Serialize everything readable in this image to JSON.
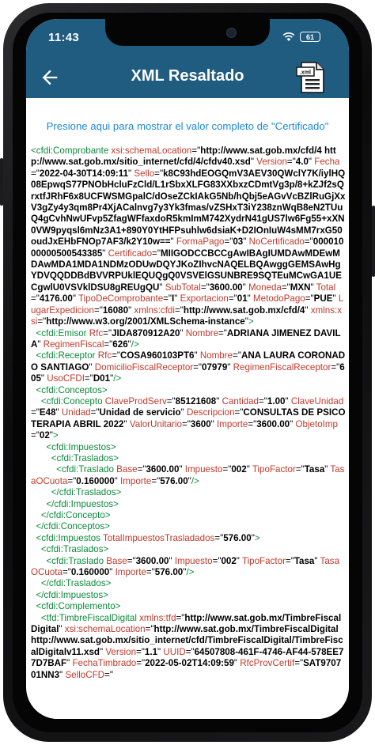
{
  "status": {
    "time": "11:43",
    "battery": "61"
  },
  "appbar": {
    "title": "XML Resaltado",
    "xml_badge": ".xml"
  },
  "link_text": "Presione aqui para mostrar el valor completo de \"Certificado\"",
  "xml_lines": [
    [
      {
        "k": "tag",
        "t": "<cfdi:Comprobante "
      },
      {
        "k": "attr",
        "t": "xsi:schemaLocation"
      },
      {
        "k": "q",
        "t": "=\""
      },
      {
        "k": "val",
        "t": "http://www.sat.gob.mx/cfd/4 http://www.sat.gob.mx/sitio_internet/cfd/4/cfdv40.xsd"
      },
      {
        "k": "q",
        "t": "\" "
      },
      {
        "k": "attr",
        "t": "Version"
      },
      {
        "k": "q",
        "t": "=\""
      },
      {
        "k": "val",
        "t": "4.0"
      },
      {
        "k": "q",
        "t": "\" "
      },
      {
        "k": "attr",
        "t": "Fecha"
      },
      {
        "k": "q",
        "t": "=\""
      },
      {
        "k": "val",
        "t": "2022-04-30T14:09:11"
      },
      {
        "k": "q",
        "t": "\" "
      },
      {
        "k": "attr",
        "t": "Sello"
      },
      {
        "k": "q",
        "t": "=\""
      },
      {
        "k": "val",
        "t": "k8C93hdEOGQmV3AEV30QWclY7K/iylHQ08EpwqS77PNObHcluFzCld/L1rSbxXLFG83XXbxzCDmtVg3p/8+kZJf2sQrxtfJRhF6x8UCFWSMGpalC/dOseZCkIAkG5Nb/hQbj5eAGvVcBZlRuGjXxV3gZy4y3qm8Pr4XjACalnvg7y3Yk3fmas/vZSHxT3iY238znWqB8eN2TUuQ4gCvhNwUFvp5ZfagWFfaxdoR5kmImM742XydrN41gUS7lw6Fg55+xXN0VW9pyqsl6mNz3A1+890Y0YtHFPsuhlw6dsiaK+D2IOnIuW4sMM7rxG50oudJxEHbFNOp7AF3/k2Y10w=="
      },
      {
        "k": "q",
        "t": "\" "
      },
      {
        "k": "attr",
        "t": "FormaPago"
      },
      {
        "k": "q",
        "t": "=\""
      },
      {
        "k": "val",
        "t": "03"
      },
      {
        "k": "q",
        "t": "\" "
      },
      {
        "k": "attr",
        "t": "NoCertificado"
      },
      {
        "k": "q",
        "t": "=\""
      },
      {
        "k": "val",
        "t": "00001000000500543385"
      },
      {
        "k": "q",
        "t": "\" "
      },
      {
        "k": "attr",
        "t": "Certificado"
      },
      {
        "k": "q",
        "t": "=\""
      },
      {
        "k": "val",
        "t": "MIIGODCCBCCgAwIBAgIUMDAwMDEwMDAwMDA1MDA1NDMzODUwDQYJKoZIhvcNAQELBQAwggGEMSAwHgYDVQQDDBdBVVRPUklEQUQgQ0VSVElGSUNBRE9SQTEuMCwGA1UECgwlU0VSVklDSU8gREUgQU"
      },
      {
        "k": "q",
        "t": "\" "
      },
      {
        "k": "attr",
        "t": "SubTotal"
      },
      {
        "k": "q",
        "t": "=\""
      },
      {
        "k": "val",
        "t": "3600.00"
      },
      {
        "k": "q",
        "t": "\" "
      },
      {
        "k": "attr",
        "t": "Moneda"
      },
      {
        "k": "q",
        "t": "=\""
      },
      {
        "k": "val",
        "t": "MXN"
      },
      {
        "k": "q",
        "t": "\" "
      },
      {
        "k": "attr",
        "t": "Total"
      },
      {
        "k": "q",
        "t": "=\""
      },
      {
        "k": "val",
        "t": "4176.00"
      },
      {
        "k": "q",
        "t": "\" "
      },
      {
        "k": "attr",
        "t": "TipoDeComprobante"
      },
      {
        "k": "q",
        "t": "=\""
      },
      {
        "k": "val",
        "t": "I"
      },
      {
        "k": "q",
        "t": "\" "
      },
      {
        "k": "attr",
        "t": "Exportacion"
      },
      {
        "k": "q",
        "t": "=\""
      },
      {
        "k": "val",
        "t": "01"
      },
      {
        "k": "q",
        "t": "\" "
      },
      {
        "k": "attr",
        "t": "MetodoPago"
      },
      {
        "k": "q",
        "t": "=\""
      },
      {
        "k": "val",
        "t": "PUE"
      },
      {
        "k": "q",
        "t": "\" "
      },
      {
        "k": "attr",
        "t": "LugarExpedicion"
      },
      {
        "k": "q",
        "t": "=\""
      },
      {
        "k": "val",
        "t": "16080"
      },
      {
        "k": "q",
        "t": "\" "
      },
      {
        "k": "attr",
        "t": "xmlns:cfdi"
      },
      {
        "k": "q",
        "t": "=\""
      },
      {
        "k": "val",
        "t": "http://www.sat.gob.mx/cfd/4"
      },
      {
        "k": "q",
        "t": "\" "
      },
      {
        "k": "attr",
        "t": "xmlns:xsi"
      },
      {
        "k": "q",
        "t": "=\""
      },
      {
        "k": "val",
        "t": "http://www.w3.org/2001/XMLSchema-instance"
      },
      {
        "k": "q",
        "t": "\""
      },
      {
        "k": "tag",
        "t": ">"
      }
    ],
    [
      {
        "k": "tag",
        "t": "  <cfdi:Emisor "
      },
      {
        "k": "attr",
        "t": "Rfc"
      },
      {
        "k": "q",
        "t": "=\""
      },
      {
        "k": "val",
        "t": "JIDA870912A20"
      },
      {
        "k": "q",
        "t": "\" "
      },
      {
        "k": "attr",
        "t": "Nombre"
      },
      {
        "k": "q",
        "t": "=\""
      },
      {
        "k": "val",
        "t": "ADRIANA JIMENEZ DAVILA"
      },
      {
        "k": "q",
        "t": "\" "
      },
      {
        "k": "attr",
        "t": "RegimenFiscal"
      },
      {
        "k": "q",
        "t": "=\""
      },
      {
        "k": "val",
        "t": "626"
      },
      {
        "k": "q",
        "t": "\""
      },
      {
        "k": "tag",
        "t": "/>"
      }
    ],
    [
      {
        "k": "tag",
        "t": "  <cfdi:Receptor "
      },
      {
        "k": "attr",
        "t": "Rfc"
      },
      {
        "k": "q",
        "t": "=\""
      },
      {
        "k": "val",
        "t": "COSA960103PT6"
      },
      {
        "k": "q",
        "t": "\" "
      },
      {
        "k": "attr",
        "t": "Nombre"
      },
      {
        "k": "q",
        "t": "=\""
      },
      {
        "k": "val",
        "t": "ANA LAURA CORONADO SANTIAGO"
      },
      {
        "k": "q",
        "t": "\" "
      },
      {
        "k": "attr",
        "t": "DomicilioFiscalReceptor"
      },
      {
        "k": "q",
        "t": "=\""
      },
      {
        "k": "val",
        "t": "07979"
      },
      {
        "k": "q",
        "t": "\" "
      },
      {
        "k": "attr",
        "t": "RegimenFiscalReceptor"
      },
      {
        "k": "q",
        "t": "=\""
      },
      {
        "k": "val",
        "t": "605"
      },
      {
        "k": "q",
        "t": "\" "
      },
      {
        "k": "attr",
        "t": "UsoCFDI"
      },
      {
        "k": "q",
        "t": "=\""
      },
      {
        "k": "val",
        "t": "D01"
      },
      {
        "k": "q",
        "t": "\""
      },
      {
        "k": "tag",
        "t": "/>"
      }
    ],
    [
      {
        "k": "tag",
        "t": "  <cfdi:Conceptos>"
      }
    ],
    [
      {
        "k": "tag",
        "t": "    <cfdi:Concepto "
      },
      {
        "k": "attr",
        "t": "ClaveProdServ"
      },
      {
        "k": "q",
        "t": "=\""
      },
      {
        "k": "val",
        "t": "85121608"
      },
      {
        "k": "q",
        "t": "\" "
      },
      {
        "k": "attr",
        "t": "Cantidad"
      },
      {
        "k": "q",
        "t": "=\""
      },
      {
        "k": "val",
        "t": "1.00"
      },
      {
        "k": "q",
        "t": "\" "
      },
      {
        "k": "attr",
        "t": "ClaveUnidad"
      },
      {
        "k": "q",
        "t": "=\""
      },
      {
        "k": "val",
        "t": "E48"
      },
      {
        "k": "q",
        "t": "\" "
      },
      {
        "k": "attr",
        "t": "Unidad"
      },
      {
        "k": "q",
        "t": "=\""
      },
      {
        "k": "val",
        "t": "Unidad de servicio"
      },
      {
        "k": "q",
        "t": "\" "
      },
      {
        "k": "attr",
        "t": "Descripcion"
      },
      {
        "k": "q",
        "t": "=\""
      },
      {
        "k": "val",
        "t": "CONSULTAS DE PSICOTERAPIA ABRIL 2022"
      },
      {
        "k": "q",
        "t": "\" "
      },
      {
        "k": "attr",
        "t": "ValorUnitario"
      },
      {
        "k": "q",
        "t": "=\""
      },
      {
        "k": "val",
        "t": "3600"
      },
      {
        "k": "q",
        "t": "\" "
      },
      {
        "k": "attr",
        "t": "Importe"
      },
      {
        "k": "q",
        "t": "=\""
      },
      {
        "k": "val",
        "t": "3600.00"
      },
      {
        "k": "q",
        "t": "\" "
      },
      {
        "k": "attr",
        "t": "ObjetoImp"
      },
      {
        "k": "q",
        "t": "=\""
      },
      {
        "k": "val",
        "t": "02"
      },
      {
        "k": "q",
        "t": "\""
      },
      {
        "k": "tag",
        "t": ">"
      }
    ],
    [
      {
        "k": "tag",
        "t": "      <cfdi:Impuestos>"
      }
    ],
    [
      {
        "k": "tag",
        "t": "        <cfdi:Traslados>"
      }
    ],
    [
      {
        "k": "tag",
        "t": "          <cfdi:Traslado "
      },
      {
        "k": "attr",
        "t": "Base"
      },
      {
        "k": "q",
        "t": "=\""
      },
      {
        "k": "val",
        "t": "3600.00"
      },
      {
        "k": "q",
        "t": "\" "
      },
      {
        "k": "attr",
        "t": "Impuesto"
      },
      {
        "k": "q",
        "t": "=\""
      },
      {
        "k": "val",
        "t": "002"
      },
      {
        "k": "q",
        "t": "\" "
      },
      {
        "k": "attr",
        "t": "TipoFactor"
      },
      {
        "k": "q",
        "t": "=\""
      },
      {
        "k": "val",
        "t": "Tasa"
      },
      {
        "k": "q",
        "t": "\" "
      },
      {
        "k": "attr",
        "t": "TasaOCuota"
      },
      {
        "k": "q",
        "t": "=\""
      },
      {
        "k": "val",
        "t": "0.160000"
      },
      {
        "k": "q",
        "t": "\" "
      },
      {
        "k": "attr",
        "t": "Importe"
      },
      {
        "k": "q",
        "t": "=\""
      },
      {
        "k": "val",
        "t": "576.00"
      },
      {
        "k": "q",
        "t": "\""
      },
      {
        "k": "tag",
        "t": "/>"
      }
    ],
    [
      {
        "k": "tag",
        "t": "        </cfdi:Traslados>"
      }
    ],
    [
      {
        "k": "tag",
        "t": "      </cfdi:Impuestos>"
      }
    ],
    [
      {
        "k": "tag",
        "t": "    </cfdi:Concepto>"
      }
    ],
    [
      {
        "k": "tag",
        "t": "  </cfdi:Conceptos>"
      }
    ],
    [
      {
        "k": "tag",
        "t": "  <cfdi:Impuestos "
      },
      {
        "k": "attr",
        "t": "TotalImpuestosTrasladados"
      },
      {
        "k": "q",
        "t": "=\""
      },
      {
        "k": "val",
        "t": "576.00"
      },
      {
        "k": "q",
        "t": "\""
      },
      {
        "k": "tag",
        "t": ">"
      }
    ],
    [
      {
        "k": "tag",
        "t": "    <cfdi:Traslados>"
      }
    ],
    [
      {
        "k": "tag",
        "t": "      <cfdi:Traslado "
      },
      {
        "k": "attr",
        "t": "Base"
      },
      {
        "k": "q",
        "t": "=\""
      },
      {
        "k": "val",
        "t": "3600.00"
      },
      {
        "k": "q",
        "t": "\" "
      },
      {
        "k": "attr",
        "t": "Impuesto"
      },
      {
        "k": "q",
        "t": "=\""
      },
      {
        "k": "val",
        "t": "002"
      },
      {
        "k": "q",
        "t": "\" "
      },
      {
        "k": "attr",
        "t": "TipoFactor"
      },
      {
        "k": "q",
        "t": "=\""
      },
      {
        "k": "val",
        "t": "Tasa"
      },
      {
        "k": "q",
        "t": "\" "
      },
      {
        "k": "attr",
        "t": "TasaOCuota"
      },
      {
        "k": "q",
        "t": "=\""
      },
      {
        "k": "val",
        "t": "0.160000"
      },
      {
        "k": "q",
        "t": "\" "
      },
      {
        "k": "attr",
        "t": "Importe"
      },
      {
        "k": "q",
        "t": "=\""
      },
      {
        "k": "val",
        "t": "576.00"
      },
      {
        "k": "q",
        "t": "\""
      },
      {
        "k": "tag",
        "t": "/>"
      }
    ],
    [
      {
        "k": "tag",
        "t": "    </cfdi:Traslados>"
      }
    ],
    [
      {
        "k": "tag",
        "t": "  </cfdi:Impuestos>"
      }
    ],
    [
      {
        "k": "tag",
        "t": "  <cfdi:Complemento>"
      }
    ],
    [
      {
        "k": "tag",
        "t": "    <tfd:TimbreFiscalDigital "
      },
      {
        "k": "attr",
        "t": "xmlns:tfd"
      },
      {
        "k": "q",
        "t": "=\""
      },
      {
        "k": "val",
        "t": "http://www.sat.gob.mx/TimbreFiscalDigital"
      },
      {
        "k": "q",
        "t": "\" "
      },
      {
        "k": "attr",
        "t": "xsi:schemaLocation"
      },
      {
        "k": "q",
        "t": "=\""
      },
      {
        "k": "val",
        "t": "http://www.sat.gob.mx/TimbreFiscalDigital http://www.sat.gob.mx/sitio_internet/cfd/TimbreFiscalDigital/TimbreFiscalDigitalv11.xsd"
      },
      {
        "k": "q",
        "t": "\" "
      },
      {
        "k": "attr",
        "t": "Version"
      },
      {
        "k": "q",
        "t": "=\""
      },
      {
        "k": "val",
        "t": "1.1"
      },
      {
        "k": "q",
        "t": "\" "
      },
      {
        "k": "attr",
        "t": "UUID"
      },
      {
        "k": "q",
        "t": "=\""
      },
      {
        "k": "val",
        "t": "64507808-461F-4746-AF44-578EE77D7BAF"
      },
      {
        "k": "q",
        "t": "\" "
      },
      {
        "k": "attr",
        "t": "FechaTimbrado"
      },
      {
        "k": "q",
        "t": "=\""
      },
      {
        "k": "val",
        "t": "2022-05-02T14:09:59"
      },
      {
        "k": "q",
        "t": "\" "
      },
      {
        "k": "attr",
        "t": "RfcProvCertif"
      },
      {
        "k": "q",
        "t": "=\""
      },
      {
        "k": "val",
        "t": "SAT970701NN3"
      },
      {
        "k": "q",
        "t": "\" "
      },
      {
        "k": "attr",
        "t": "SelloCFD"
      },
      {
        "k": "q",
        "t": "=\""
      }
    ]
  ],
  "colors": {
    "appbar": "#1f5c80",
    "tag": "#0b8a3a",
    "attr": "#c0392b",
    "link": "#1e88d6"
  },
  "icons": [
    "back-arrow-icon",
    "xml-file-icon",
    "wifi-icon",
    "battery-icon"
  ]
}
